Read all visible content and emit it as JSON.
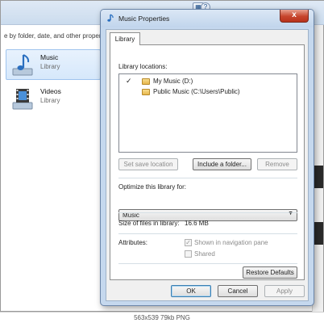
{
  "explorer": {
    "arrange_text": "e by folder, date, and other proper",
    "items": [
      {
        "name": "Music",
        "sub": "Library",
        "icon": "music-library-icon"
      },
      {
        "name": "Videos",
        "sub": "Library",
        "icon": "video-library-icon"
      }
    ]
  },
  "dialog": {
    "title": "Music Properties",
    "close_label": "x",
    "tab_label": "Library",
    "locations_label": "Library locations:",
    "locations": [
      {
        "checked": true,
        "check_mark": "✓",
        "text": "My Music (D:)"
      },
      {
        "checked": false,
        "check_mark": "",
        "text": "Public Music (C:\\Users\\Public)"
      }
    ],
    "buttons": {
      "set_save_location": "Set save location",
      "include_folder": "Include a folder...",
      "remove": "Remove",
      "restore_defaults": "Restore Defaults",
      "ok": "OK",
      "cancel": "Cancel",
      "apply": "Apply"
    },
    "optimize_label": "Optimize this library for:",
    "optimize_value": "Music",
    "size_label": "Size of files in library:",
    "size_value": "16.6 MB",
    "attributes_label": "Attributes:",
    "attributes": [
      {
        "label": "Shown in navigation pane",
        "checked": true,
        "check_mark": "✓"
      },
      {
        "label": "Shared",
        "checked": false,
        "check_mark": ""
      }
    ]
  },
  "caption": "563x539 79kb PNG"
}
